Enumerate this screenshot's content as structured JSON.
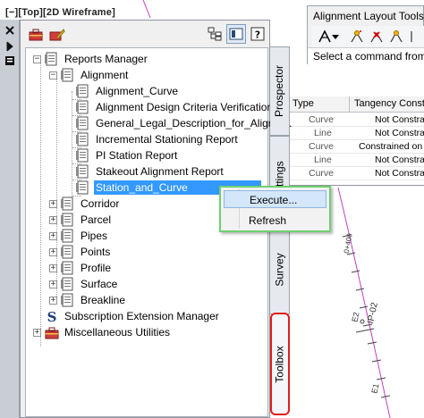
{
  "viewport": {
    "label": "[−][Top][2D Wireframe]"
  },
  "alignment_tools": {
    "title": "Alignment Layout Tools",
    "status": "Select a command from the"
  },
  "grid": {
    "headers": [
      "Type",
      "Tangency Constraint"
    ],
    "rows": [
      [
        "Curve",
        "Not Constrained"
      ],
      [
        "Line",
        "Not Constrained"
      ],
      [
        "Curve",
        "Constrained on Both"
      ],
      [
        "Line",
        "Not Constrained"
      ],
      [
        "Curve",
        "Not Constrained"
      ]
    ]
  },
  "tree": {
    "reports_manager": "Reports Manager",
    "alignment": "Alignment",
    "alignment_reports": [
      "Alignment_Curve",
      "Alignment Design Criteria Verification",
      "General_Legal_Description_for_Alignm...",
      "Incremental Stationing Report",
      "PI Station Report",
      "Stakeout Alignment Report",
      "Station_and_Curve"
    ],
    "categories": [
      "Corridor",
      "Parcel",
      "Pipes",
      "Points",
      "Profile",
      "Surface",
      "Breakline"
    ],
    "subscription": "Subscription Extension Manager",
    "misc": "Miscellaneous Utilities"
  },
  "tabs": {
    "prospector": "Prospector",
    "settings": "Settings",
    "survey": "Survey",
    "toolbox": "Toolbox"
  },
  "context_menu": {
    "execute": "Execute...",
    "refresh": "Refresh"
  },
  "drawing": {
    "station_label": "0+400",
    "pi_label": "IP-02",
    "e2_label": "E2",
    "e1_label": "E1"
  },
  "colors": {
    "alignment_line": "#c040c0",
    "selection": "#3399ff",
    "highlight_outline_red": "#e01e1e",
    "menu_outline_green": "#6fd06f"
  }
}
